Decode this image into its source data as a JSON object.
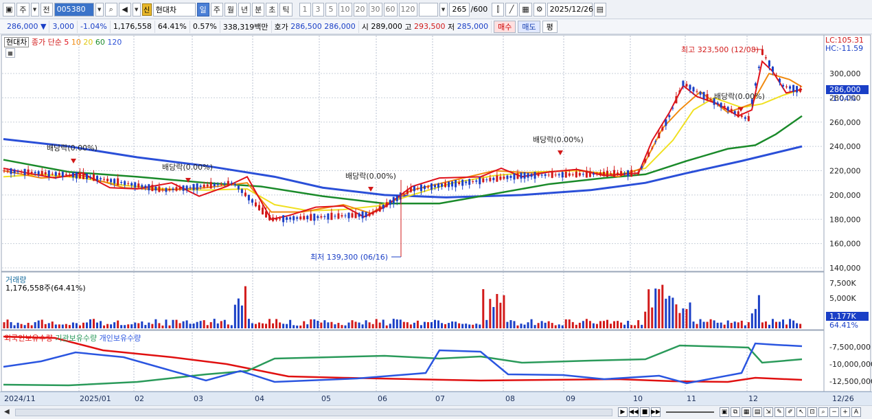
{
  "toolbar": {
    "period_toggle": "주",
    "prev_label": "전",
    "stock_code": "005380",
    "new_badge": "신",
    "stock_name": "현대차",
    "periods": [
      "일",
      "주",
      "월",
      "년",
      "분",
      "초",
      "틱"
    ],
    "numbers": [
      "1",
      "3",
      "5",
      "10",
      "20",
      "30",
      "60",
      "120"
    ],
    "count_display": "265",
    "count_total": "/600",
    "date": "2025/12/26"
  },
  "quote": {
    "price": "286,000",
    "change": "3,000",
    "change_pct": "-1.04%",
    "volume": "1,176,558",
    "volume_ratio": "64.41%",
    "turnover_rate": "0.57%",
    "trade_value": "338,319백만",
    "bid_label": "호가",
    "bid": "286,500",
    "ask": "286,000",
    "open_label": "시",
    "open": "289,000",
    "high_label": "고",
    "high": "293,500",
    "low_label": "저",
    "low": "285,000",
    "buy_label": "매수",
    "sell_label": "매도",
    "pyeong_label": "평"
  },
  "price_panel": {
    "stock_tag": "현대차",
    "legend_close": "종가 단순",
    "ma_labels": [
      "5",
      "10",
      "20",
      "60",
      "120"
    ],
    "lc_label": "LC:105.31",
    "hc_label": "HC:-11.59",
    "current_price_tag": "286,000",
    "current_change_tag": "-1.04%",
    "y_ticks": [
      "300,000",
      "280,000",
      "260,000",
      "240,000",
      "220,000",
      "200,000",
      "180,000",
      "160,000",
      "140,000"
    ],
    "high_annotation": "최고 323,500 (12/08)",
    "low_annotation": "최저 139,300 (06/16)",
    "dividend_labels": [
      "배당락(0.00%)",
      "배당락(0.00%)",
      "배당락(0.00%)",
      "배당락(0.00%)",
      "배당락(0.00%)"
    ]
  },
  "volume_panel": {
    "title": "거래량",
    "value": "1,176,558주(64.41%)",
    "y_ticks": [
      "7,500K",
      "5,000K"
    ],
    "current_tag": "1,177K",
    "current_pct": "64.41%"
  },
  "holding_panel": {
    "legend": [
      "외국인보유수량",
      "기관보유수량",
      "개인보유수량"
    ],
    "y_ticks": [
      "-7,500,000",
      "-10,000,000",
      "-12,500,000"
    ]
  },
  "x_axis": {
    "labels": [
      "2024/11",
      "2025/01",
      "02",
      "03",
      "04",
      "05",
      "06",
      "07",
      "08",
      "09",
      "10",
      "11",
      "12"
    ],
    "right_label": "12/26"
  },
  "colors": {
    "up": "#d21a1a",
    "down": "#1a3fc6",
    "ma5": "#e0101a",
    "ma10": "#f08a10",
    "ma20": "#f0e020",
    "ma60": "#1a8a2a",
    "ma120": "#2a4fd8",
    "foreign": "#e01010",
    "institution": "#2a9a5a",
    "individual": "#2a55e0"
  }
}
